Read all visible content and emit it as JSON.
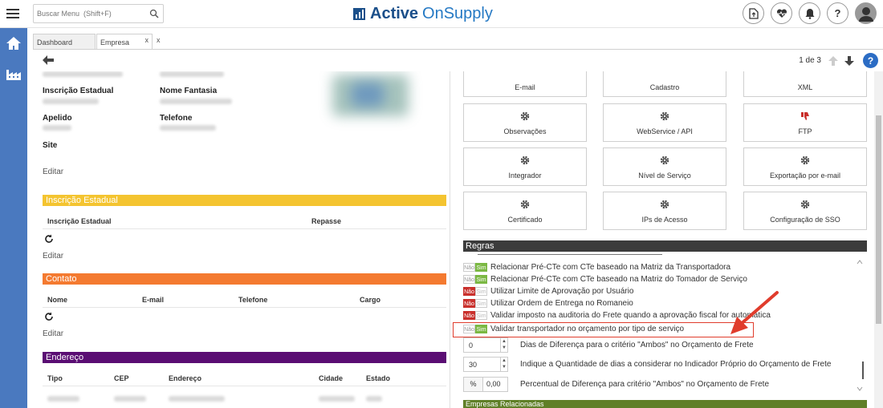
{
  "search": {
    "placeholder": "Buscar Menu  (Shift+F)"
  },
  "logo": {
    "bold": "Active",
    "light": "OnSupply"
  },
  "top_icons": [
    "document-upload-icon",
    "heart-pulse-icon",
    "bell-icon",
    "help-icon",
    "user-avatar-icon"
  ],
  "left_nav": [
    "home-icon",
    "factory-icon"
  ],
  "tabs": [
    {
      "label": "Dashboard",
      "active": false
    },
    {
      "label": "Empresa",
      "active": true,
      "close": "x"
    }
  ],
  "tabs_extra": "x",
  "pager": {
    "label": "1 de 3"
  },
  "help_label": "?",
  "left": {
    "fields": {
      "inscricao_estadual": "Inscrição Estadual",
      "nome_fantasia": "Nome Fantasia",
      "apelido": "Apelido",
      "telefone": "Telefone",
      "site": "Site"
    },
    "edit_label": "Editar",
    "sections": {
      "inscricao": {
        "title": "Inscrição Estadual",
        "color": "#f4c430",
        "columns": [
          "Inscrição Estadual",
          "Repasse"
        ],
        "edit": "Editar"
      },
      "contato": {
        "title": "Contato",
        "color": "#f47a30",
        "columns": [
          "Nome",
          "E-mail",
          "Telefone",
          "Cargo"
        ],
        "edit": "Editar"
      },
      "endereco": {
        "title": "Endereço",
        "color": "#5a0d73",
        "columns": [
          "Tipo",
          "CEP",
          "Endereço",
          "Cidade",
          "Estado"
        ]
      }
    }
  },
  "right": {
    "cards_row0": [
      "E-mail",
      "Cadastro",
      "XML"
    ],
    "cards": [
      {
        "label": "Observações",
        "icon": "gear-icon"
      },
      {
        "label": "WebService / API",
        "icon": "gear-icon"
      },
      {
        "label": "FTP",
        "icon": "thumbs-down-icon"
      },
      {
        "label": "Integrador",
        "icon": "gear-icon"
      },
      {
        "label": "Nível de Serviço",
        "icon": "gear-icon"
      },
      {
        "label": "Exportação por e-mail",
        "icon": "gear-icon"
      },
      {
        "label": "Certificado",
        "icon": "gear-icon"
      },
      {
        "label": "IPs de Acesso",
        "icon": "gear-icon"
      },
      {
        "label": "Configuração de SSO",
        "icon": "gear-icon"
      }
    ],
    "regras_title": "Regras",
    "toggle_no": "Não",
    "toggle_yes": "Sim",
    "rules": [
      {
        "text": "Relacionar Pré-CTe com CTe baseado na Matriz da Transportadora",
        "state": "yes"
      },
      {
        "text": "Relacionar Pré-CTe com CTe baseado na Matriz do Tomador de Serviço",
        "state": "yes"
      },
      {
        "text": "Utilizar Limite de Aprovação por Usuário",
        "state": "no"
      },
      {
        "text": "Utilizar Ordem de Entrega no Romaneio",
        "state": "no"
      },
      {
        "text": "Validar imposto na auditoria do Frete quando a aprovação fiscal for automática",
        "state": "no"
      },
      {
        "text": "Validar transportador no orçamento por tipo de serviço",
        "state": "yes"
      }
    ],
    "numeric": [
      {
        "value": "0",
        "label": "Dias de Diferença para o critério \"Ambos\" no Orçamento de Frete"
      },
      {
        "value": "30",
        "label": "Indique a Quantidade de dias a considerar no Indicador Próprio do Orçamento de Frete"
      }
    ],
    "percent": {
      "prefix": "%",
      "value": "0,00",
      "label": "Percentual de Diferença para critério \"Ambos\" no Orçamento de Frete"
    },
    "green_section": "Empresas Relacionadas"
  },
  "colors": {
    "nav": "#4a79bf",
    "brand": "#1b4f8a",
    "brand_light": "#2579c4",
    "highlight": "#e03c2c"
  }
}
